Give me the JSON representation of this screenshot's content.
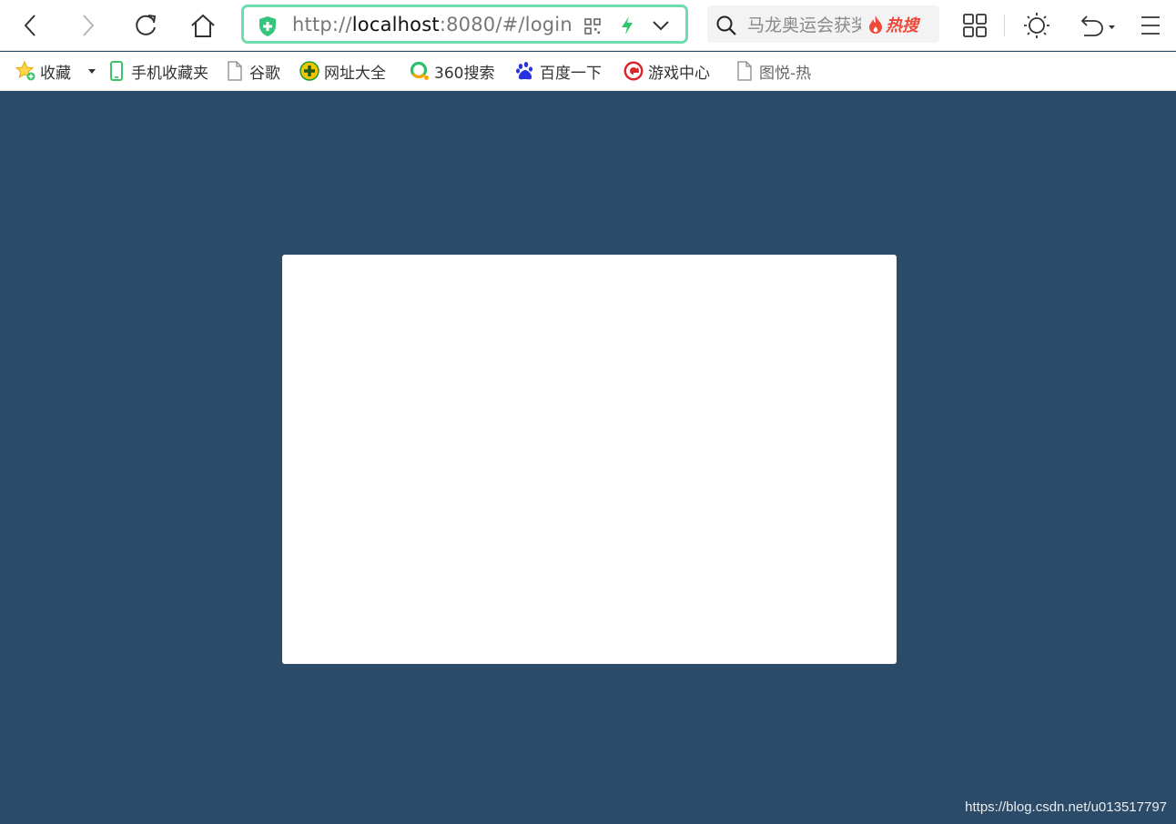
{
  "browser": {
    "address_bar": {
      "url_scheme": "http://",
      "url_host": "localhost",
      "url_rest": ":8080/#/login"
    },
    "search": {
      "placeholder": "马龙奥运会获奖",
      "hot_label": "热搜"
    },
    "accent_color": "#6fdcae"
  },
  "bookmarks": [
    {
      "label": "收藏",
      "icon": "star-icon"
    },
    {
      "label": "手机收藏夹",
      "icon": "phone-icon"
    },
    {
      "label": "谷歌",
      "icon": "page-icon"
    },
    {
      "label": "网址大全",
      "icon": "site-nav-icon"
    },
    {
      "label": "360搜索",
      "icon": "360-search-icon"
    },
    {
      "label": "百度一下",
      "icon": "baidu-paw-icon"
    },
    {
      "label": "游戏中心",
      "icon": "game-center-icon"
    },
    {
      "label": "图悦-热",
      "icon": "page-icon"
    }
  ],
  "page": {
    "background_color": "#2b4b69",
    "watermark": "https://blog.csdn.net/u013517797"
  }
}
